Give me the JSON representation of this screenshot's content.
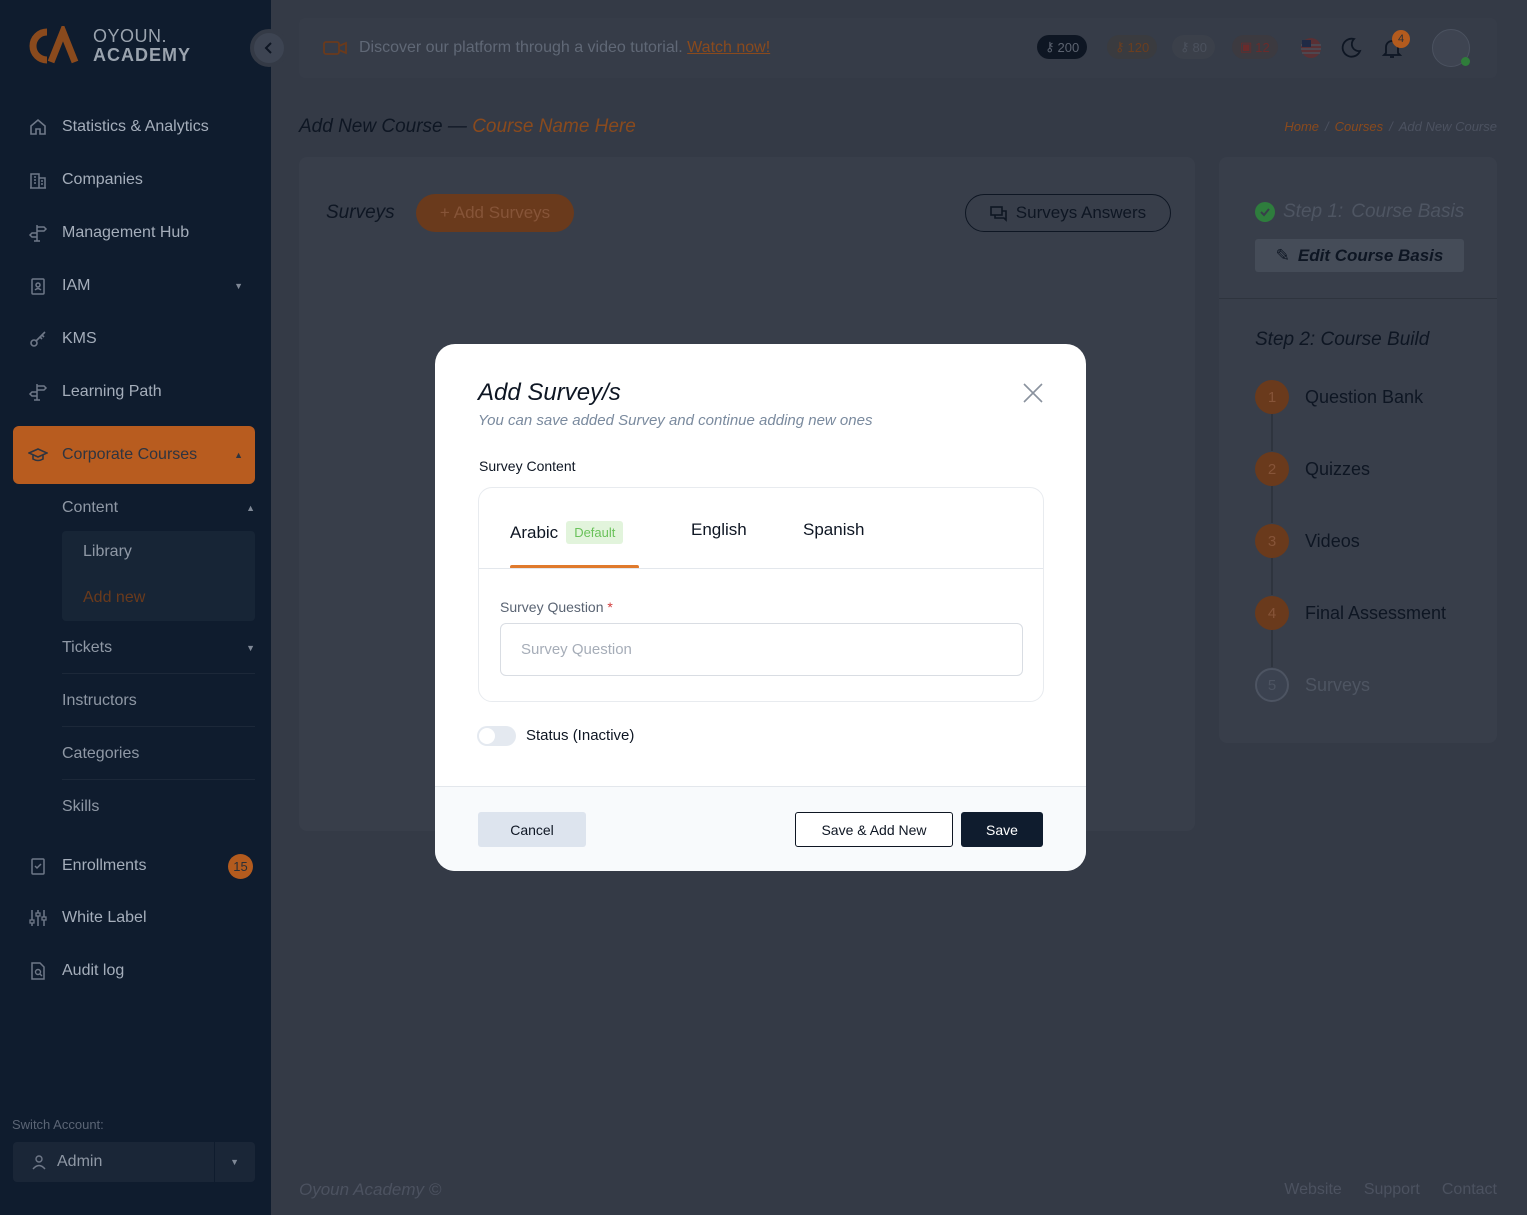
{
  "brand": {
    "line1": "OYOUN.",
    "line2": "ACADEMY"
  },
  "sidebar": {
    "items": [
      {
        "label": "Statistics & Analytics",
        "icon": "home-icon"
      },
      {
        "label": "Companies",
        "icon": "building-icon"
      },
      {
        "label": "Management Hub",
        "icon": "signpost-icon"
      },
      {
        "label": "IAM",
        "icon": "id-badge-icon"
      },
      {
        "label": "KMS",
        "icon": "key-icon"
      },
      {
        "label": "Learning Path",
        "icon": "signpost-icon"
      },
      {
        "label": "Corporate Courses",
        "icon": "graduation-cap-icon"
      }
    ],
    "content_label": "Content",
    "content_sub": [
      "Library",
      "Add new"
    ],
    "sub_items": [
      "Tickets",
      "Instructors",
      "Categories",
      "Skills"
    ],
    "bottom_items": [
      {
        "label": "Enrollments",
        "icon": "clipboard-check-icon",
        "badge": "15"
      },
      {
        "label": "White Label",
        "icon": "sliders-icon"
      },
      {
        "label": "Audit log",
        "icon": "file-search-icon"
      }
    ],
    "switch_account_label": "Switch Account:",
    "switch_account_value": "Admin"
  },
  "topbar": {
    "message": "Discover our platform through a video tutorial.",
    "link": "Watch now!",
    "pills": [
      "200",
      "120",
      "80",
      "12"
    ],
    "notification_count": "4"
  },
  "page": {
    "title_prefix": "Add New Course —",
    "title_accent": "Course Name Here",
    "breadcrumb": [
      "Home",
      "Courses",
      "Add New Course"
    ]
  },
  "main": {
    "section_title": "Surveys",
    "add_button": "Add Surveys",
    "answers_button": "Surveys Answers"
  },
  "steps": {
    "step1_label": "Step 1:",
    "step1_name": "Course Basis",
    "edit_button": "Edit Course Basis",
    "step2_label": "Step 2:",
    "step2_name": "Course Build",
    "items": [
      {
        "num": "1",
        "label": "Question Bank"
      },
      {
        "num": "2",
        "label": "Quizzes"
      },
      {
        "num": "3",
        "label": "Videos"
      },
      {
        "num": "4",
        "label": "Final Assessment"
      },
      {
        "num": "5",
        "label": "Surveys"
      }
    ]
  },
  "footer": {
    "copyright": "Oyoun Academy ©",
    "links": [
      "Website",
      "Support",
      "Contact"
    ]
  },
  "modal": {
    "title": "Add Survey/s",
    "subtitle": "You can save added Survey and continue adding new ones",
    "content_label": "Survey Content",
    "tabs": [
      "Arabic",
      "English",
      "Spanish"
    ],
    "default_badge": "Default",
    "question_label": "Survey Question",
    "required_mark": "*",
    "question_placeholder": "Survey Question",
    "question_value": "",
    "status_label": "Status (Inactive)",
    "cancel": "Cancel",
    "save_add": "Save & Add New",
    "save": "Save"
  },
  "colors": {
    "sidebar_bg": "#0f1c2e",
    "accent": "#e07a2c",
    "overlay_bg": "#343a46",
    "primary_dark": "#0f1c2e"
  }
}
